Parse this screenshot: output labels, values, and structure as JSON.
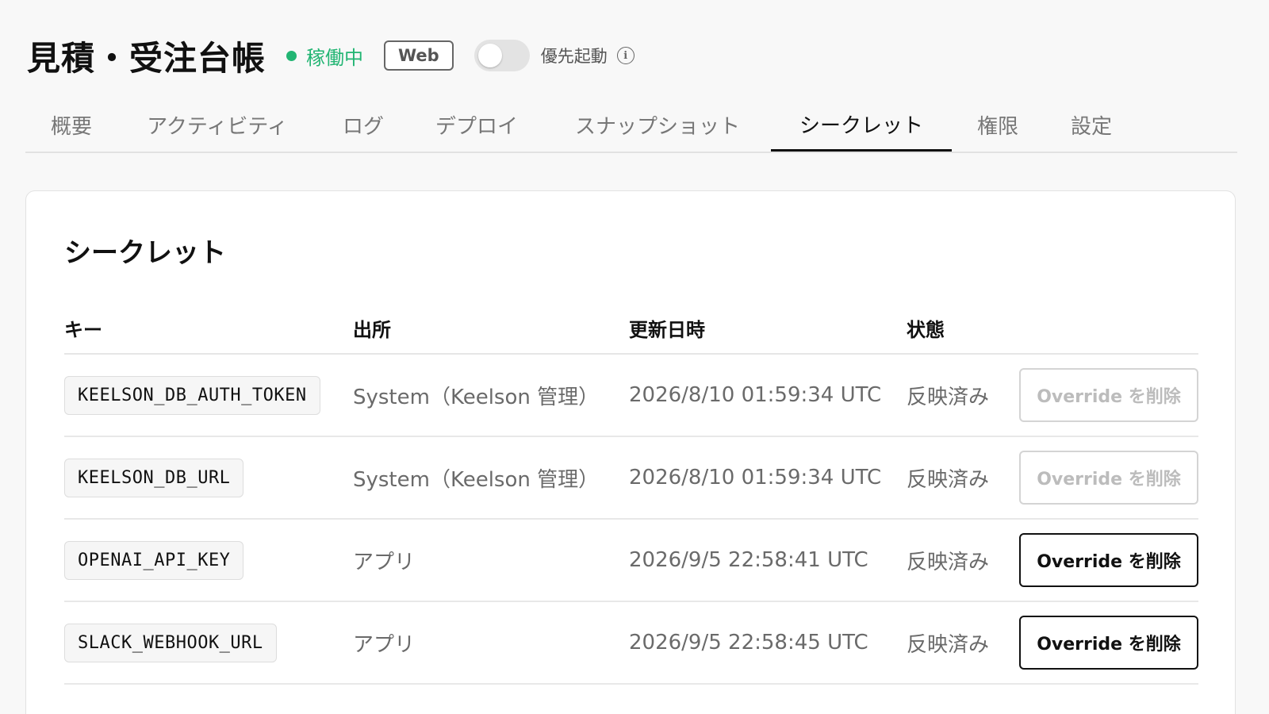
{
  "header": {
    "title": "見積・受注台帳",
    "status": "稼働中",
    "status_color": "#22b573",
    "badge": "Web",
    "toggle_on": false,
    "priority_label": "優先起動",
    "info_icon": "i"
  },
  "tabs": [
    {
      "label": "概要",
      "active": false
    },
    {
      "label": "アクティビティ",
      "active": false
    },
    {
      "label": "ログ",
      "active": false
    },
    {
      "label": "デプロイ",
      "active": false
    },
    {
      "label": "スナップショット",
      "active": false
    },
    {
      "label": "シークレット",
      "active": true
    },
    {
      "label": "権限",
      "active": false
    },
    {
      "label": "設定",
      "active": false
    }
  ],
  "card": {
    "title": "シークレット",
    "columns": {
      "key": "キー",
      "source": "出所",
      "updated": "更新日時",
      "state": "状態"
    },
    "rows": [
      {
        "key": "KEELSON_DB_AUTH_TOKEN",
        "source": "System（Keelson 管理）",
        "updated": "2026/8/10 01:59:34 UTC",
        "state": "反映済み",
        "action": "Override を削除",
        "action_enabled": false
      },
      {
        "key": "KEELSON_DB_URL",
        "source": "System（Keelson 管理）",
        "updated": "2026/8/10 01:59:34 UTC",
        "state": "反映済み",
        "action": "Override を削除",
        "action_enabled": false
      },
      {
        "key": "OPENAI_API_KEY",
        "source": "アプリ",
        "updated": "2026/9/5 22:58:41 UTC",
        "state": "反映済み",
        "action": "Override を削除",
        "action_enabled": true
      },
      {
        "key": "SLACK_WEBHOOK_URL",
        "source": "アプリ",
        "updated": "2026/9/5 22:58:45 UTC",
        "state": "反映済み",
        "action": "Override を削除",
        "action_enabled": true
      }
    ]
  }
}
